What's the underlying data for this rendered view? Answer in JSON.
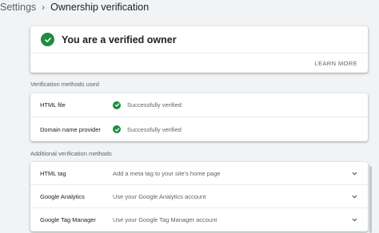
{
  "header": {
    "breadcrumb": "Settings",
    "title": "Ownership verification"
  },
  "owner_card": {
    "title": "You are a verified owner",
    "learn_more": "LEARN MORE"
  },
  "methods_used": {
    "label": "Verification methods used",
    "items": [
      {
        "name": "HTML file",
        "status": "Successfully verified"
      },
      {
        "name": "Domain name provider",
        "status": "Successfully verified"
      }
    ]
  },
  "additional": {
    "label": "Additional verification methods",
    "items": [
      {
        "name": "HTML tag",
        "description": "Add a meta tag to your site's home page"
      },
      {
        "name": "Google Analytics",
        "description": "Use your Google Analytics account"
      },
      {
        "name": "Google Tag Manager",
        "description": "Use your Google Tag Manager account"
      }
    ]
  },
  "colors": {
    "verified_green": "#1e8e3e",
    "background": "#f1f3f4"
  }
}
